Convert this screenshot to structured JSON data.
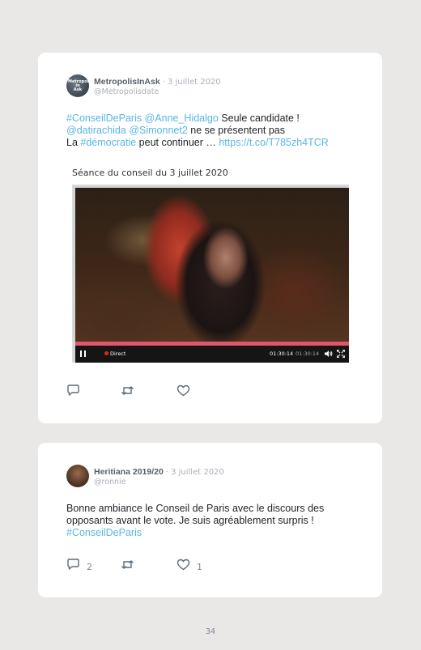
{
  "tweets": [
    {
      "avatar_text": [
        "Metropolis",
        "in",
        "Ask"
      ],
      "name": "MetropolisInAsk",
      "date": "· 3 juillet 2020",
      "handle": "@Metropolisdate",
      "text_lines": [
        [
          {
            "t": "#ConseilDeParis",
            "link": true
          },
          {
            "t": " ",
            "link": false
          },
          {
            "t": "@Anne_Hidalgo",
            "link": true
          },
          {
            "t": " Seule candidate !",
            "link": false
          }
        ],
        [
          {
            "t": "@datirachida",
            "link": true
          },
          {
            "t": " ",
            "link": false
          },
          {
            "t": "@Simonnet2",
            "link": true
          },
          {
            "t": " ne se présentent pas",
            "link": false
          }
        ],
        [
          {
            "t": "La ",
            "link": false
          },
          {
            "t": "#démocratie",
            "link": true
          },
          {
            "t": " peut continuer … ",
            "link": false
          },
          {
            "t": "https://t.co/T785zh4TCR",
            "link": true
          }
        ]
      ],
      "video": {
        "caption": "Séance du conseil du 3 juillet 2020",
        "live_label": "Direct",
        "time_current": "01:30:14",
        "time_total": "01:30:14",
        "progress": 1.0,
        "progress_color": "#e0566a"
      },
      "actions": {
        "reply_count": "",
        "retweet_count": "",
        "like_count": ""
      }
    },
    {
      "name": "Heritiana 2019/20",
      "date": "· 3 juillet 2020",
      "handle": "@ronnie",
      "text_lines": [
        [
          {
            "t": "Bonne ambiance le Conseil de Paris avec le discours des",
            "link": false
          }
        ],
        [
          {
            "t": "opposants avant le vote. Je suis agréablement surpris !",
            "link": false
          }
        ],
        [
          {
            "t": "#ConseilDeParis",
            "link": true
          }
        ]
      ],
      "actions": {
        "reply_count": "2",
        "retweet_count": "",
        "like_count": "1"
      }
    }
  ],
  "icons": {
    "reply": "reply-icon",
    "retweet": "retweet-icon",
    "like": "heart-icon",
    "pause": "pause-icon",
    "volume": "volume-icon",
    "fullscreen": "fullscreen-icon"
  },
  "colors": {
    "link": "#58b6e4",
    "background": "#e9e8e6",
    "card": "#ffffff",
    "icon": "#5b6b7a"
  },
  "page_number": "34"
}
